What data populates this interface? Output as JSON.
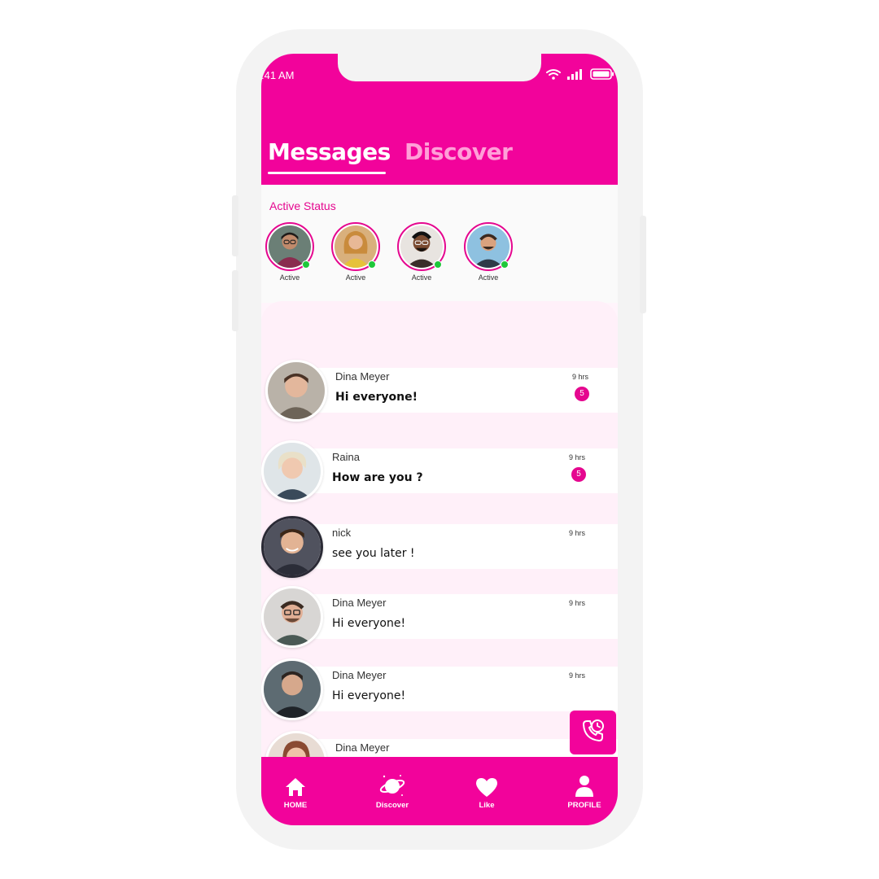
{
  "status_bar": {
    "time": ":41 AM"
  },
  "tabs": [
    {
      "label": "Messages",
      "active": true
    },
    {
      "label": "Discover",
      "active": false
    }
  ],
  "active_status": {
    "title": "Active Status",
    "users": [
      {
        "label": "Active"
      },
      {
        "label": "Active"
      },
      {
        "label": "Active"
      },
      {
        "label": "Active"
      }
    ]
  },
  "chats": [
    {
      "name": "Dina Meyer",
      "message": "Hi everyone!",
      "time": "9 hrs",
      "unread": "5"
    },
    {
      "name": "Raina",
      "message": "How are you ?",
      "time": "9 hrs",
      "unread": "5"
    },
    {
      "name": "nick",
      "message": "see you later !",
      "time": "9 hrs"
    },
    {
      "name": "Dina Meyer",
      "message": "Hi everyone!",
      "time": "9 hrs"
    },
    {
      "name": "Dina Meyer",
      "message": "Hi everyone!",
      "time": "9 hrs"
    },
    {
      "name": "Dina Meyer"
    }
  ],
  "bottom_nav": [
    {
      "label": "HOME",
      "icon": "home-icon"
    },
    {
      "label": "Discover",
      "icon": "planet-icon"
    },
    {
      "label": "Like",
      "icon": "heart-icon"
    },
    {
      "label": "PROFILE",
      "icon": "user-icon"
    }
  ],
  "colors": {
    "brand": "#f2039b",
    "accent": "#e5078f",
    "online": "#1ec73a",
    "list_bg": "#fff0f9"
  }
}
